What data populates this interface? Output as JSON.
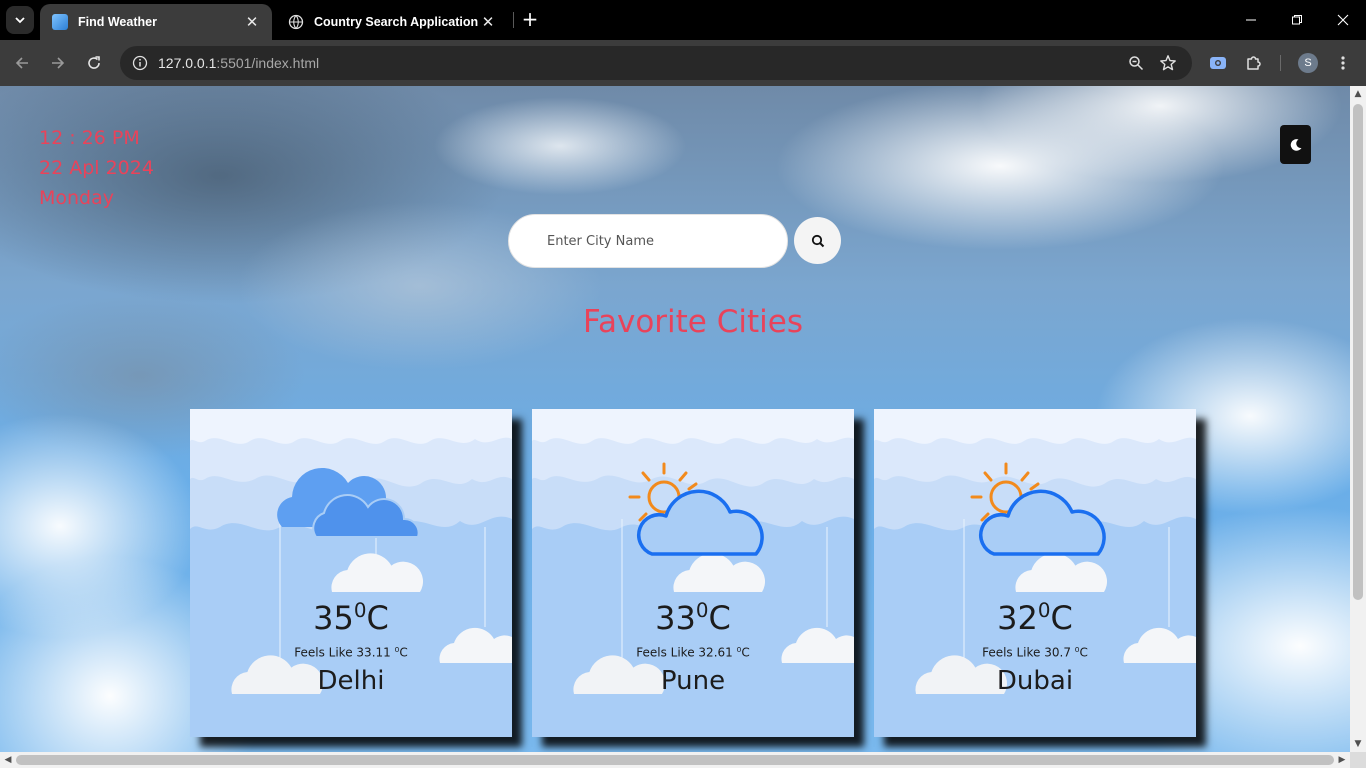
{
  "browser": {
    "tabs": [
      {
        "title": "Find Weather",
        "active": true,
        "icon": "weather-favicon"
      },
      {
        "title": "Country Search Application",
        "active": false,
        "icon": "globe-icon"
      }
    ],
    "url_host": "127.0.0.1",
    "url_rest": ":5501/index.html",
    "profile_initial": "S"
  },
  "page": {
    "time": "12 : 26 PM",
    "date": "22 Apl 2024",
    "day": "Monday",
    "search_placeholder": "Enter City Name",
    "section_title": "Favorite Cities",
    "degree_symbol": "0",
    "temp_unit": "C",
    "feels_prefix": "Feels Like",
    "cities": [
      {
        "name": "Delhi",
        "temp": "35",
        "feels_like": "33.11",
        "icon": "cloudy-icon"
      },
      {
        "name": "Pune",
        "temp": "33",
        "feels_like": "32.61",
        "icon": "partly-sunny-icon"
      },
      {
        "name": "Dubai",
        "temp": "32",
        "feels_like": "30.7",
        "icon": "partly-sunny-icon"
      }
    ]
  },
  "colors": {
    "accent_text": "#e9435a",
    "card_background": "#a9cdf6",
    "sun_orange": "#f28a1c",
    "cloud_outline_blue": "#1a6ff0",
    "cloud_fill_blue": "#5e9ff1"
  }
}
